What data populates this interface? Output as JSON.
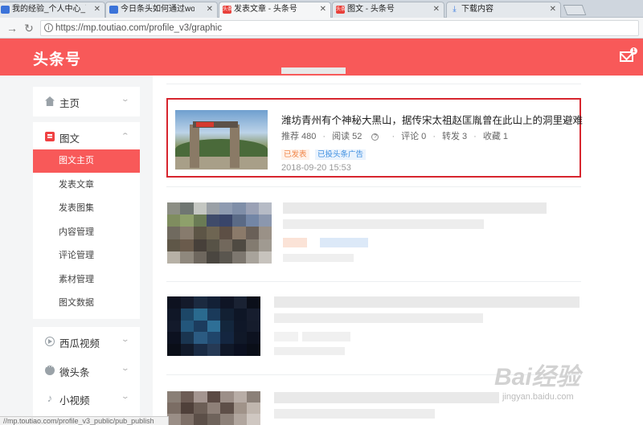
{
  "browser": {
    "tabs": [
      {
        "label": "我的经验_个人中心_百度经验"
      },
      {
        "label": "今日条头如何通过word发…"
      },
      {
        "label": "发表文章 - 头条号"
      },
      {
        "label": "图文 - 头条号"
      },
      {
        "label": "下载内容"
      }
    ],
    "url": "https://mp.toutiao.com/profile_v3/graphic",
    "status_url": "//mp.toutiao.com/profile_v3_public/pub_publish"
  },
  "header": {
    "logo": "头条号",
    "mail_badge": "1"
  },
  "sidebar": {
    "home": "主页",
    "graphic": "图文",
    "graphic_sub": [
      "图文主页",
      "发表文章",
      "发表图集",
      "内容管理",
      "评论管理",
      "素材管理",
      "图文数据"
    ],
    "xigua": "西瓜视频",
    "weitoutiao": "微头条",
    "short_video": "小视频"
  },
  "article": {
    "title": "潍坊青州有个神秘大黑山，据传宋太祖赵匡胤曾在此山上的洞里避难",
    "recommend": "推荐 480",
    "read": "阅读 52",
    "comment": "评论 0",
    "share": "转发 3",
    "favorite": "收藏 1",
    "badge_published": "已发表",
    "badge_ad": "已投头条广告",
    "date": "2018-09-20 15:53"
  },
  "watermark": {
    "brand": "Bai经验",
    "url": "jingyan.baidu.com"
  }
}
